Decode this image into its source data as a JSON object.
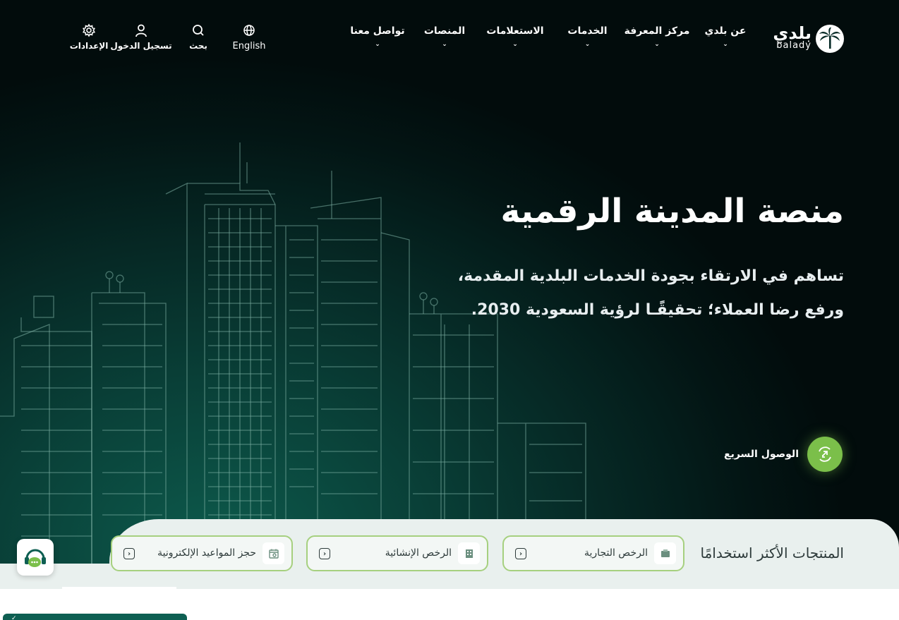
{
  "header": {
    "logo_ar": "بلدي",
    "logo_en": "balady",
    "nav": [
      {
        "label": "عن بلدي",
        "has_dropdown": true
      },
      {
        "label": "مركز المعرفة",
        "has_dropdown": true
      },
      {
        "label": "الخدمات",
        "has_dropdown": true
      },
      {
        "label": "الاستعلامات",
        "has_dropdown": true
      },
      {
        "label": "المنصات",
        "has_dropdown": true
      },
      {
        "label": "تواصل معنا",
        "has_dropdown": true
      }
    ],
    "tools": [
      {
        "label": "English",
        "icon": "globe-icon"
      },
      {
        "label": "بحث",
        "icon": "search-icon"
      },
      {
        "label": "تسجيل الدخول",
        "icon": "user-icon"
      },
      {
        "label": "الإعدادات",
        "icon": "gear-icon"
      }
    ]
  },
  "hero": {
    "title": "منصة المدينة الرقمية",
    "subtitle": "تساهم في الارتقاء بجودة الخدمات البلدية المقدمة، ورفع رضا العملاء؛ تحقيقًـا لرؤية السعودية 2030.",
    "quick_access": "الوصول السريع"
  },
  "products": {
    "title": "المنتجات الأكثر استخدامًا",
    "items": [
      {
        "label": "الرخص التجارية",
        "icon": "commercial-license-icon"
      },
      {
        "label": "الرخص الإنشائية",
        "icon": "building-license-icon"
      },
      {
        "label": "حجز المواعيد الإلكترونية",
        "icon": "appointment-icon"
      }
    ]
  },
  "colors": {
    "accent_green": "#7bbf4a",
    "card_border": "#a6d07f",
    "hero_dark": "#031514",
    "hero_teal": "#0d5a4c"
  }
}
